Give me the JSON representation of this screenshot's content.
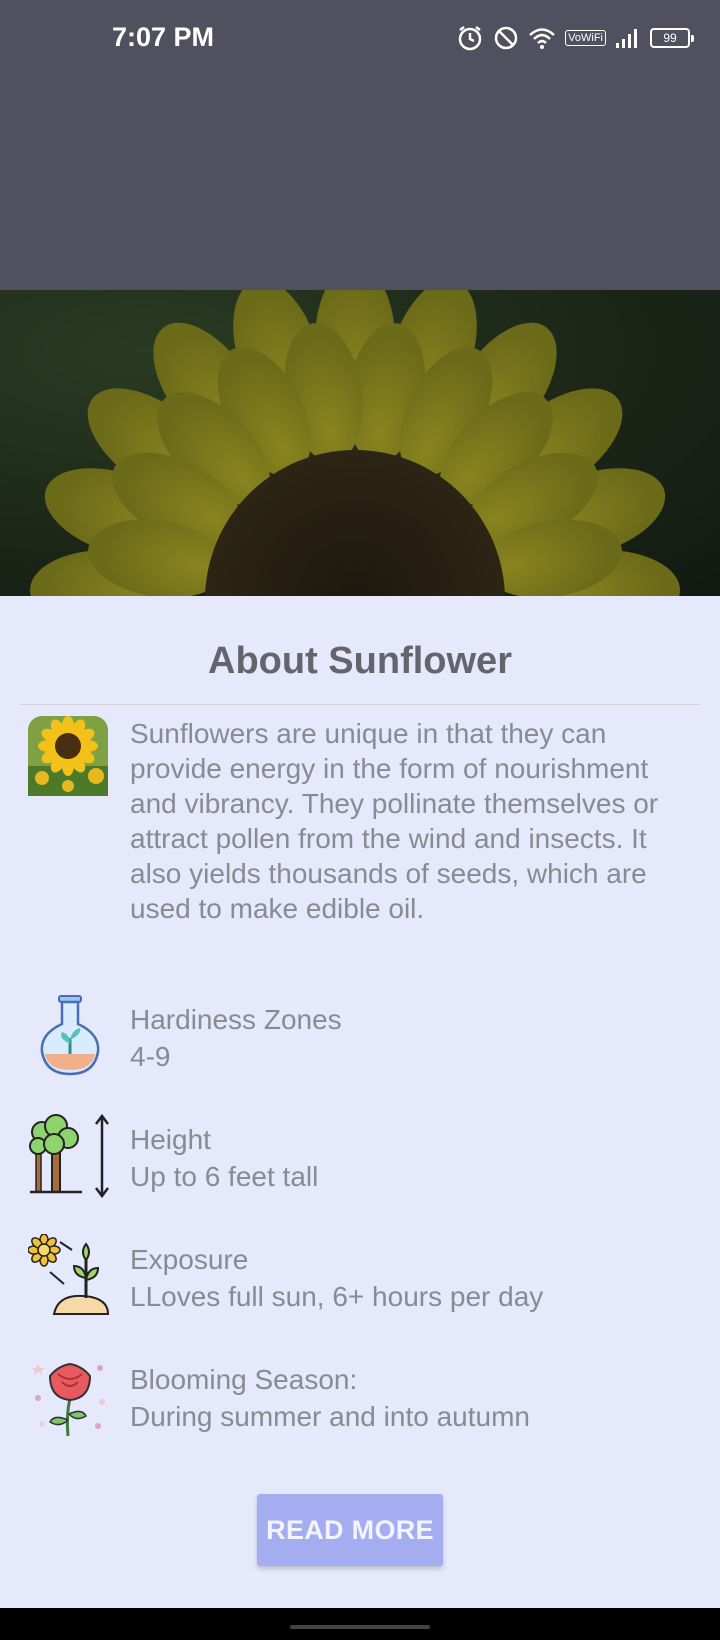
{
  "status_bar": {
    "time": "7:07 PM",
    "vowifi": "VoWiFi",
    "battery": "99",
    "icons": [
      "alarm-icon",
      "do-not-disturb-icon",
      "wifi-icon",
      "vowifi-icon",
      "signal-icon",
      "battery-icon"
    ]
  },
  "hero": {
    "icon": "sunflower-photo"
  },
  "about": {
    "title": "About Sunflower",
    "description": "Sunflowers are unique in that they can provide energy in the form of nourishment and vibrancy. They pollinate themselves or attract pollen from the wind and insects. It also yields thousands of seeds, which are used to make edible oil.",
    "description_icon": "sunflower-thumbnail-icon",
    "facts": [
      {
        "label": "Hardiness Zones",
        "value": "4-9",
        "icon": "flask-sprout-icon"
      },
      {
        "label": "Height",
        "value": "Up to 6 feet tall",
        "icon": "tree-height-icon"
      },
      {
        "label": "Exposure",
        "value": "LLoves full sun, 6+ hours per day",
        "icon": "sun-plant-icon"
      },
      {
        "label": "Blooming Season:",
        "value": "During summer and into autumn",
        "icon": "rose-bloom-icon"
      }
    ],
    "read_more_label": "READ MORE"
  },
  "colors": {
    "status_bar_bg": "#50505f",
    "content_bg": "#e6e9fb",
    "title_text": "#65646c",
    "body_text": "#8a8a92",
    "button_bg": "#a4adf0",
    "button_text": "#f3f4ff"
  }
}
